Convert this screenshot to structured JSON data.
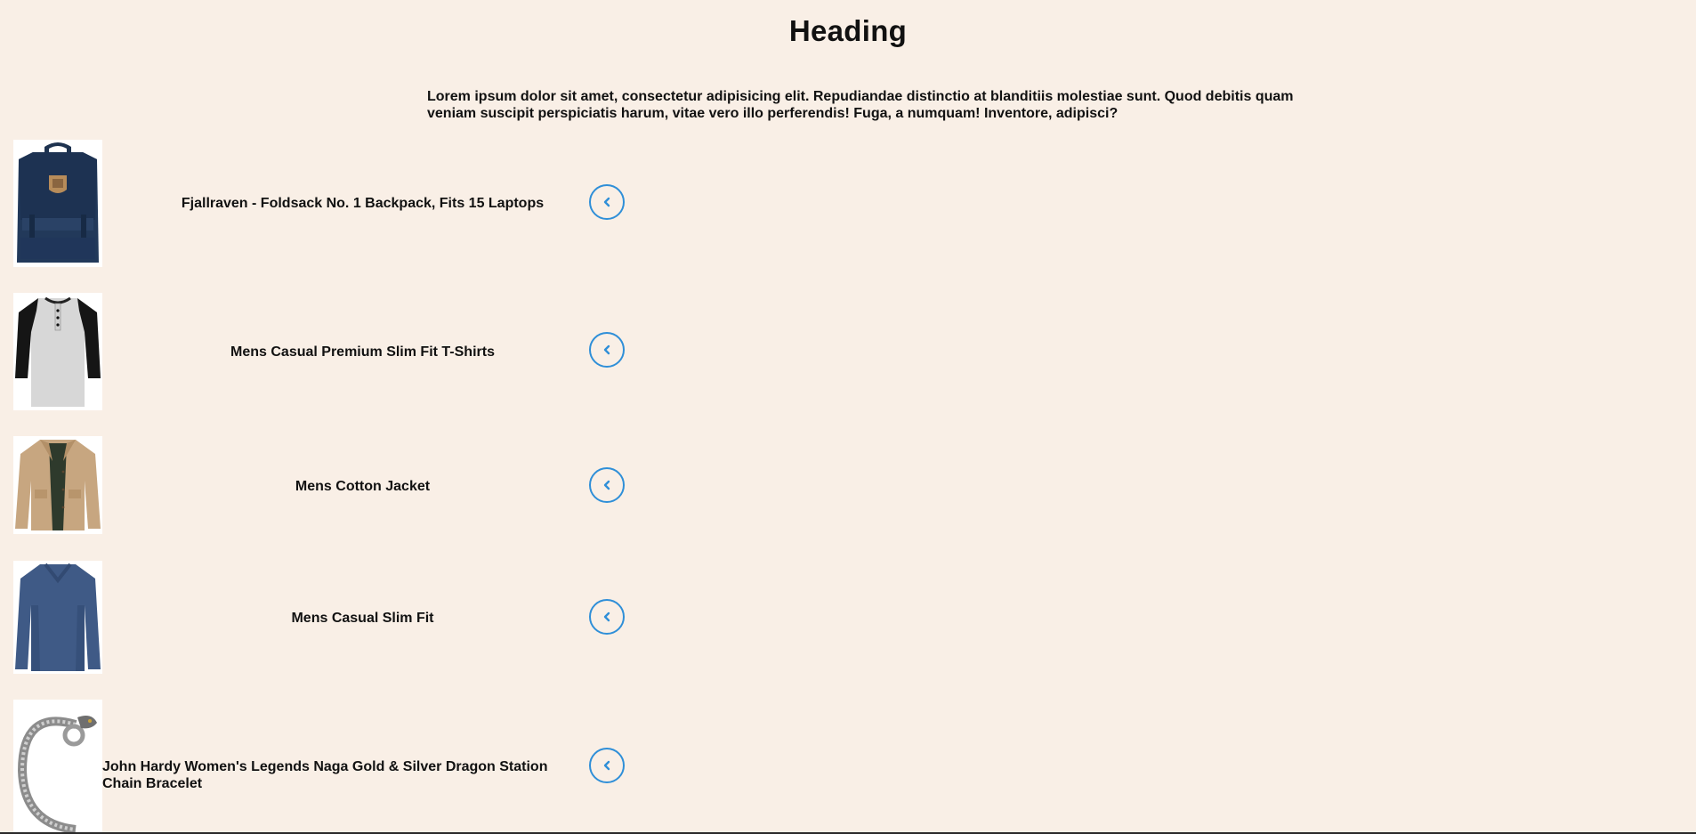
{
  "page": {
    "heading": "Heading",
    "intro": "Lorem ipsum dolor sit amet, consectetur adipisicing elit. Repudiandae distinctio at blanditiis molestiae sunt. Quod debitis quam veniam suscipit perspiciatis harum, vitae vero illo perferendis! Fuga, a numquam! Inventore, adipisci?"
  },
  "colors": {
    "background": "#f9efe6",
    "accent": "#2f8fd8"
  },
  "products": [
    {
      "title": "Fjallraven - Foldsack No. 1 Backpack, Fits 15 Laptops",
      "image": "backpack-image",
      "icon": "chevron-left-icon"
    },
    {
      "title": "Mens Casual Premium Slim Fit T-Shirts",
      "image": "raglan-tshirt-image",
      "icon": "chevron-left-icon"
    },
    {
      "title": "Mens Cotton Jacket",
      "image": "cotton-jacket-image",
      "icon": "chevron-left-icon"
    },
    {
      "title": "Mens Casual Slim Fit",
      "image": "long-sleeve-shirt-image",
      "icon": "chevron-left-icon"
    },
    {
      "title": "John Hardy Women's Legends Naga Gold & Silver Dragon Station Chain Bracelet",
      "image": "dragon-bracelet-image",
      "icon": "chevron-left-icon"
    }
  ]
}
